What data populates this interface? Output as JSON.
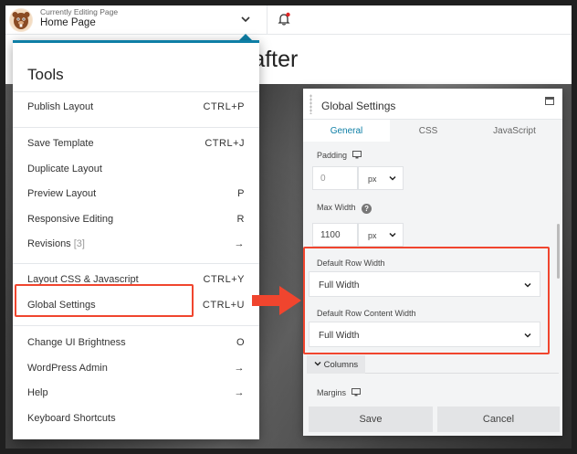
{
  "topbar": {
    "editing_label": "Currently Editing Page",
    "page_name": "Home Page"
  },
  "page": {
    "title_fragment": "rafter"
  },
  "tools_menu": {
    "heading": "Tools",
    "items": [
      {
        "label": "Publish Layout",
        "shortcut": "CTRL+P"
      },
      {
        "label": "Save Template",
        "shortcut": "CTRL+J"
      },
      {
        "label": "Duplicate Layout",
        "shortcut": ""
      },
      {
        "label": "Preview Layout",
        "shortcut": "P"
      },
      {
        "label": "Responsive Editing",
        "shortcut": "R"
      },
      {
        "label": "Revisions",
        "count": "[3]",
        "shortcut": "→"
      },
      {
        "label": "Layout CSS & Javascript",
        "shortcut": "CTRL+Y"
      },
      {
        "label": "Global Settings",
        "shortcut": "CTRL+U"
      },
      {
        "label": "Change UI Brightness",
        "shortcut": "O"
      },
      {
        "label": "WordPress Admin",
        "shortcut": "→"
      },
      {
        "label": "Help",
        "shortcut": "→"
      },
      {
        "label": "Keyboard Shortcuts",
        "shortcut": ""
      }
    ]
  },
  "global_settings": {
    "title": "Global Settings",
    "tabs": [
      "General",
      "CSS",
      "JavaScript"
    ],
    "active_tab": "General",
    "padding": {
      "label": "Padding",
      "value": "0",
      "unit": "px"
    },
    "max_width": {
      "label": "Max Width",
      "value": "1100",
      "unit": "px",
      "help": "?"
    },
    "default_row_width": {
      "label": "Default Row Width",
      "value": "Full Width"
    },
    "default_row_content_width": {
      "label": "Default Row Content Width",
      "value": "Full Width"
    },
    "columns_section": "Columns",
    "margins": {
      "label": "Margins"
    },
    "save_label": "Save",
    "cancel_label": "Cancel"
  },
  "colors": {
    "accent": "#0e7fa6",
    "highlight": "#f0452e",
    "notification": "#e02424"
  }
}
